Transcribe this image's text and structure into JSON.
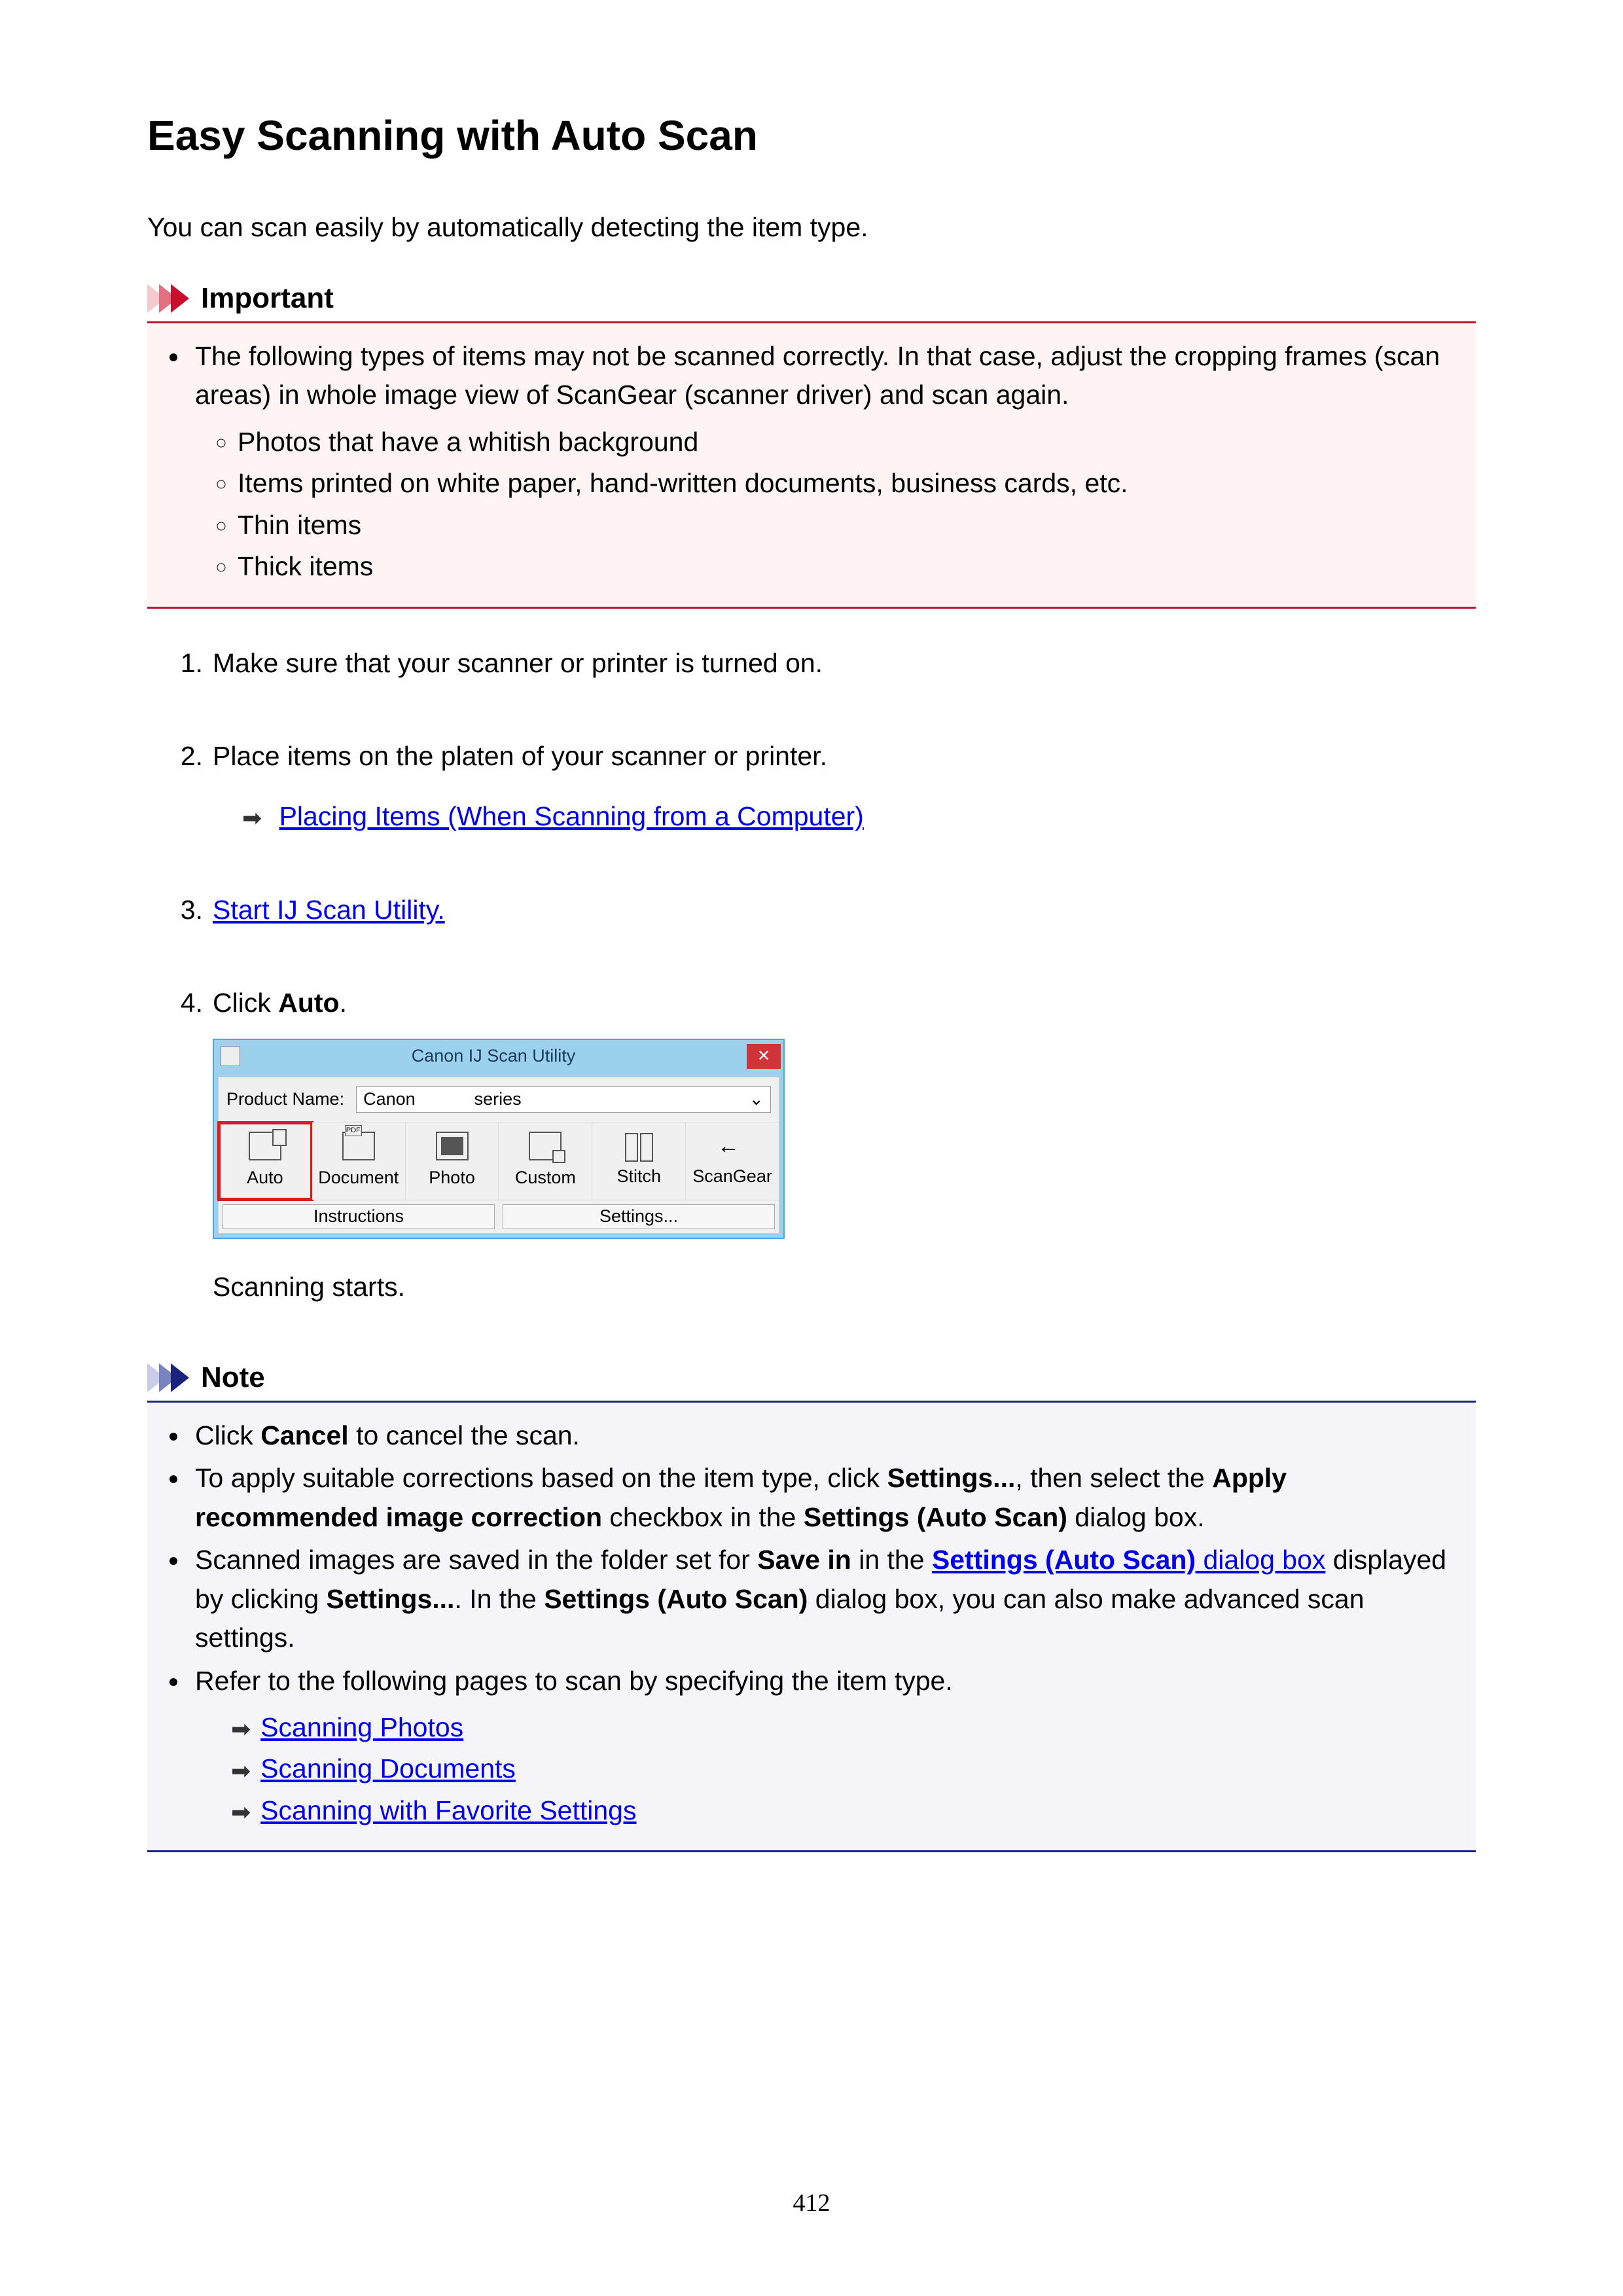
{
  "title": "Easy Scanning with Auto Scan",
  "intro": "You can scan easily by automatically detecting the item type.",
  "important": {
    "heading": "Important",
    "lead": "The following types of items may not be scanned correctly. In that case, adjust the cropping frames (scan areas) in whole image view of ScanGear (scanner driver) and scan again.",
    "items": [
      "Photos that have a whitish background",
      "Items printed on white paper, hand-written documents, business cards, etc.",
      "Thin items",
      "Thick items"
    ]
  },
  "steps": {
    "s1": "Make sure that your scanner or printer is turned on.",
    "s2": "Place items on the platen of your scanner or printer.",
    "s2_link": "Placing Items (When Scanning from a Computer)",
    "s3_link": "Start IJ Scan Utility.",
    "s4_pre": "Click ",
    "s4_bold": "Auto",
    "s4_post": ".",
    "s4_extra": "Scanning starts."
  },
  "scan_util": {
    "title": "Canon IJ Scan Utility",
    "product_name_label": "Product Name:",
    "product_value": "Canon            series",
    "buttons": [
      "Auto",
      "Document",
      "Photo",
      "Custom",
      "Stitch",
      "ScanGear"
    ],
    "instructions": "Instructions",
    "settings": "Settings..."
  },
  "note": {
    "heading": "Note",
    "n1_a": "Click ",
    "n1_bold": "Cancel",
    "n1_b": " to cancel the scan.",
    "n2_a": "To apply suitable corrections based on the item type, click ",
    "n2_b1": "Settings...",
    "n2_c": ", then select the ",
    "n2_b2": "Apply recommended image correction",
    "n2_d": " checkbox in the ",
    "n2_b3": "Settings (Auto Scan)",
    "n2_e": " dialog box.",
    "n3_a": "Scanned images are saved in the folder set for ",
    "n3_b1": "Save in",
    "n3_b": " in the ",
    "n3_link_bold": "Settings (Auto Scan)",
    "n3_link_tail": " dialog box",
    "n3_c": " displayed by clicking ",
    "n3_b2": "Settings...",
    "n3_d": ". In the ",
    "n3_b3": "Settings (Auto Scan)",
    "n3_e": " dialog box, you can also make advanced scan settings.",
    "n4": "Refer to the following pages to scan by specifying the item type.",
    "links": [
      "Scanning Photos",
      "Scanning Documents",
      "Scanning with Favorite Settings"
    ]
  },
  "page_number": "412"
}
